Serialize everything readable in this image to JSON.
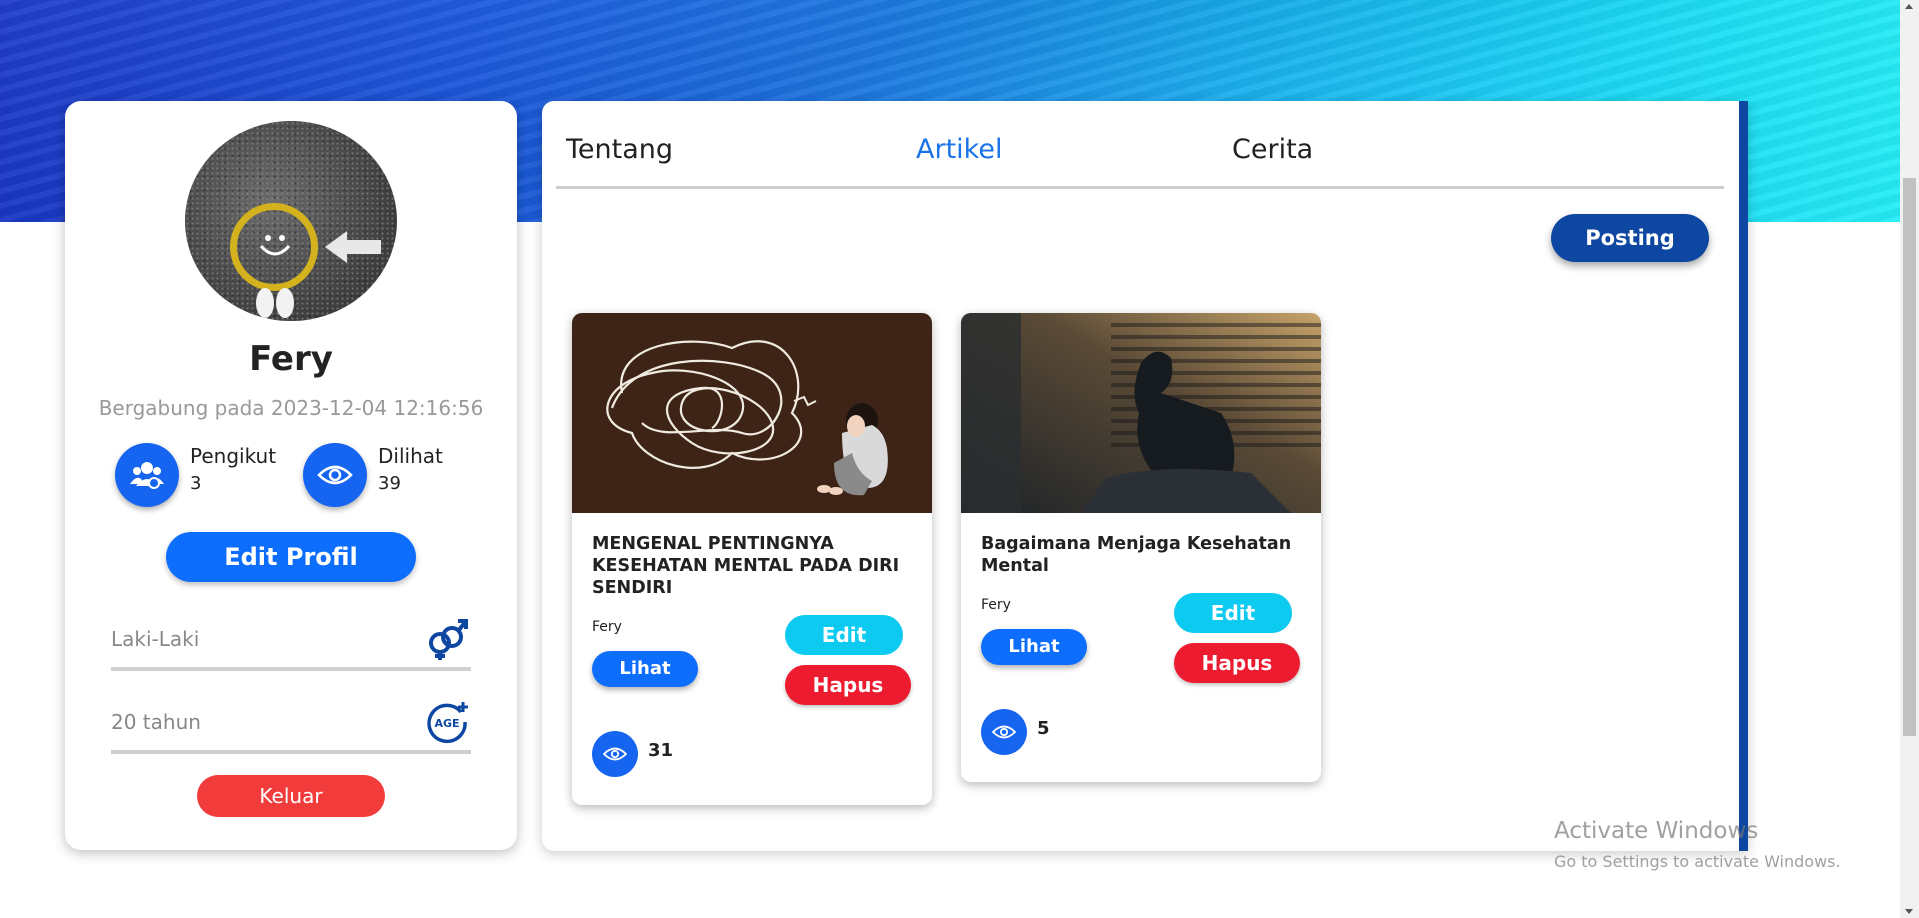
{
  "profile": {
    "name": "Fery",
    "joined": "Bergabung pada 2023-12-04 12:16:56",
    "followers_label": "Pengikut",
    "followers_count": "3",
    "views_label": "Dilihat",
    "views_count": "39",
    "edit_profile_label": "Edit Profil",
    "gender": "Laki-Laki",
    "age": "20 tahun",
    "logout_label": "Keluar"
  },
  "tabs": [
    {
      "label": "Tentang"
    },
    {
      "label": "Artikel",
      "active": true
    },
    {
      "label": "Cerita"
    }
  ],
  "posting_label": "Posting",
  "articles": [
    {
      "title": "MENGENAL PENTINGNYA KESEHATAN MENTAL PADA DIRI SENDIRI",
      "author": "Fery",
      "view_label": "Lihat",
      "edit_label": "Edit",
      "delete_label": "Hapus",
      "views": "31"
    },
    {
      "title": "Bagaimana Menjaga Kesehatan Mental",
      "author": "Fery",
      "view_label": "Lihat",
      "edit_label": "Edit",
      "delete_label": "Hapus",
      "views": "5"
    }
  ],
  "watermark": {
    "line1": "Activate Windows",
    "line2": "Go to Settings to activate Windows."
  },
  "colors": {
    "primary": "#0d6efd",
    "dark_blue": "#0d47a1",
    "cyan": "#0dcaf0",
    "danger": "#ed1b2f",
    "logout": "#f23b3b"
  }
}
